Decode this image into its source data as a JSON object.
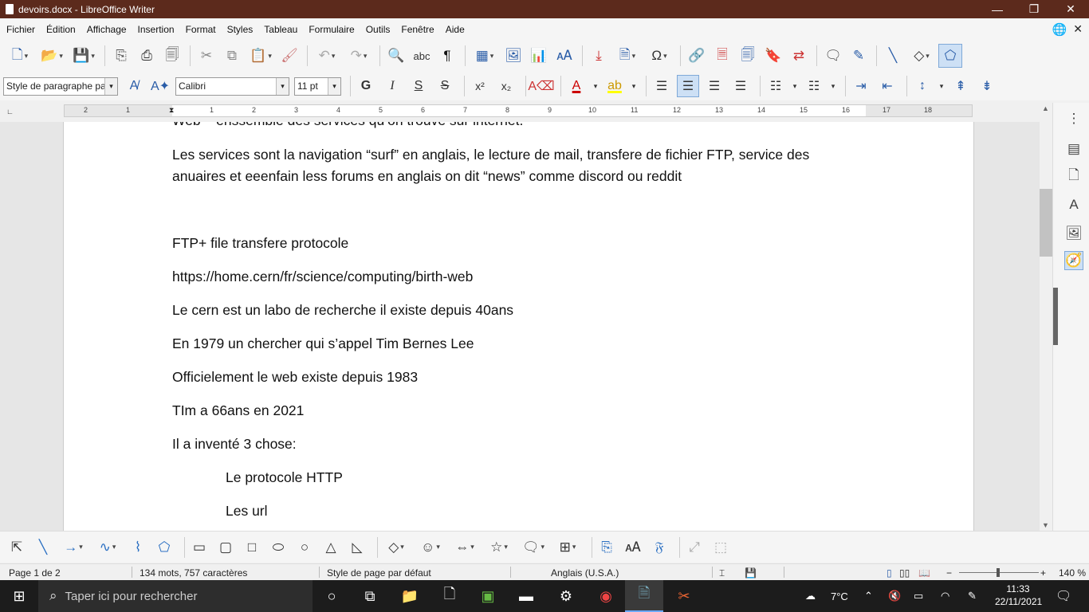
{
  "window": {
    "title": "devoirs.docx - LibreOffice Writer",
    "minimize": "—",
    "maximize": "❐",
    "close": "✕"
  },
  "menu": [
    "Fichier",
    "Édition",
    "Affichage",
    "Insertion",
    "Format",
    "Styles",
    "Tableau",
    "Formulaire",
    "Outils",
    "Fenêtre",
    "Aide"
  ],
  "formatting": {
    "paragraph_style": "Style de paragraphe par",
    "font_name": "Calibri",
    "font_size": "11 pt",
    "bold": "G",
    "italic": "I",
    "underline": "S",
    "strike": "S",
    "superscript": "x²",
    "subscript": "x₂"
  },
  "ruler": {
    "numbers": [
      "2",
      "1",
      "1",
      "2",
      "3",
      "4",
      "5",
      "6",
      "7",
      "8",
      "9",
      "10",
      "11",
      "12",
      "13",
      "14",
      "15",
      "16",
      "17",
      "18"
    ]
  },
  "document": {
    "cut_line": "Web – enssemble des services qu’on trouve sur internet.",
    "para1_line1": "Les services sont la navigation “surf” en anglais, le lecture de mail, transfere de fichier FTP, service des",
    "para1_line2": "anuaires et eeenfain less forums en anglais on dit “news” comme discord ou reddit",
    "ftp": "FTP+ file transfere protocole",
    "url": " https://home.cern/fr/science/computing/birth-web",
    "cern": "Le cern est un labo de recherche il existe depuis 40ans",
    "y1979": "En 1979 un chercher qui s’appel Tim Bernes Lee",
    "official": "Officielement le web existe depuis 1983",
    "tim": "TIm a 66ans en 2021",
    "invented": "Il a inventé 3 chose:",
    "http": "Le protocole HTTP",
    "url_item": "Les url"
  },
  "status": {
    "page": "Page 1 de 2",
    "words": "134 mots, 757 caractères",
    "page_style": "Style de page par défaut",
    "language": "Anglais (U.S.A.)",
    "zoom": "140 %"
  },
  "taskbar": {
    "search_placeholder": "Taper ici pour rechercher",
    "temperature": "7°C",
    "time": "11:33",
    "date": "22/11/2021"
  }
}
